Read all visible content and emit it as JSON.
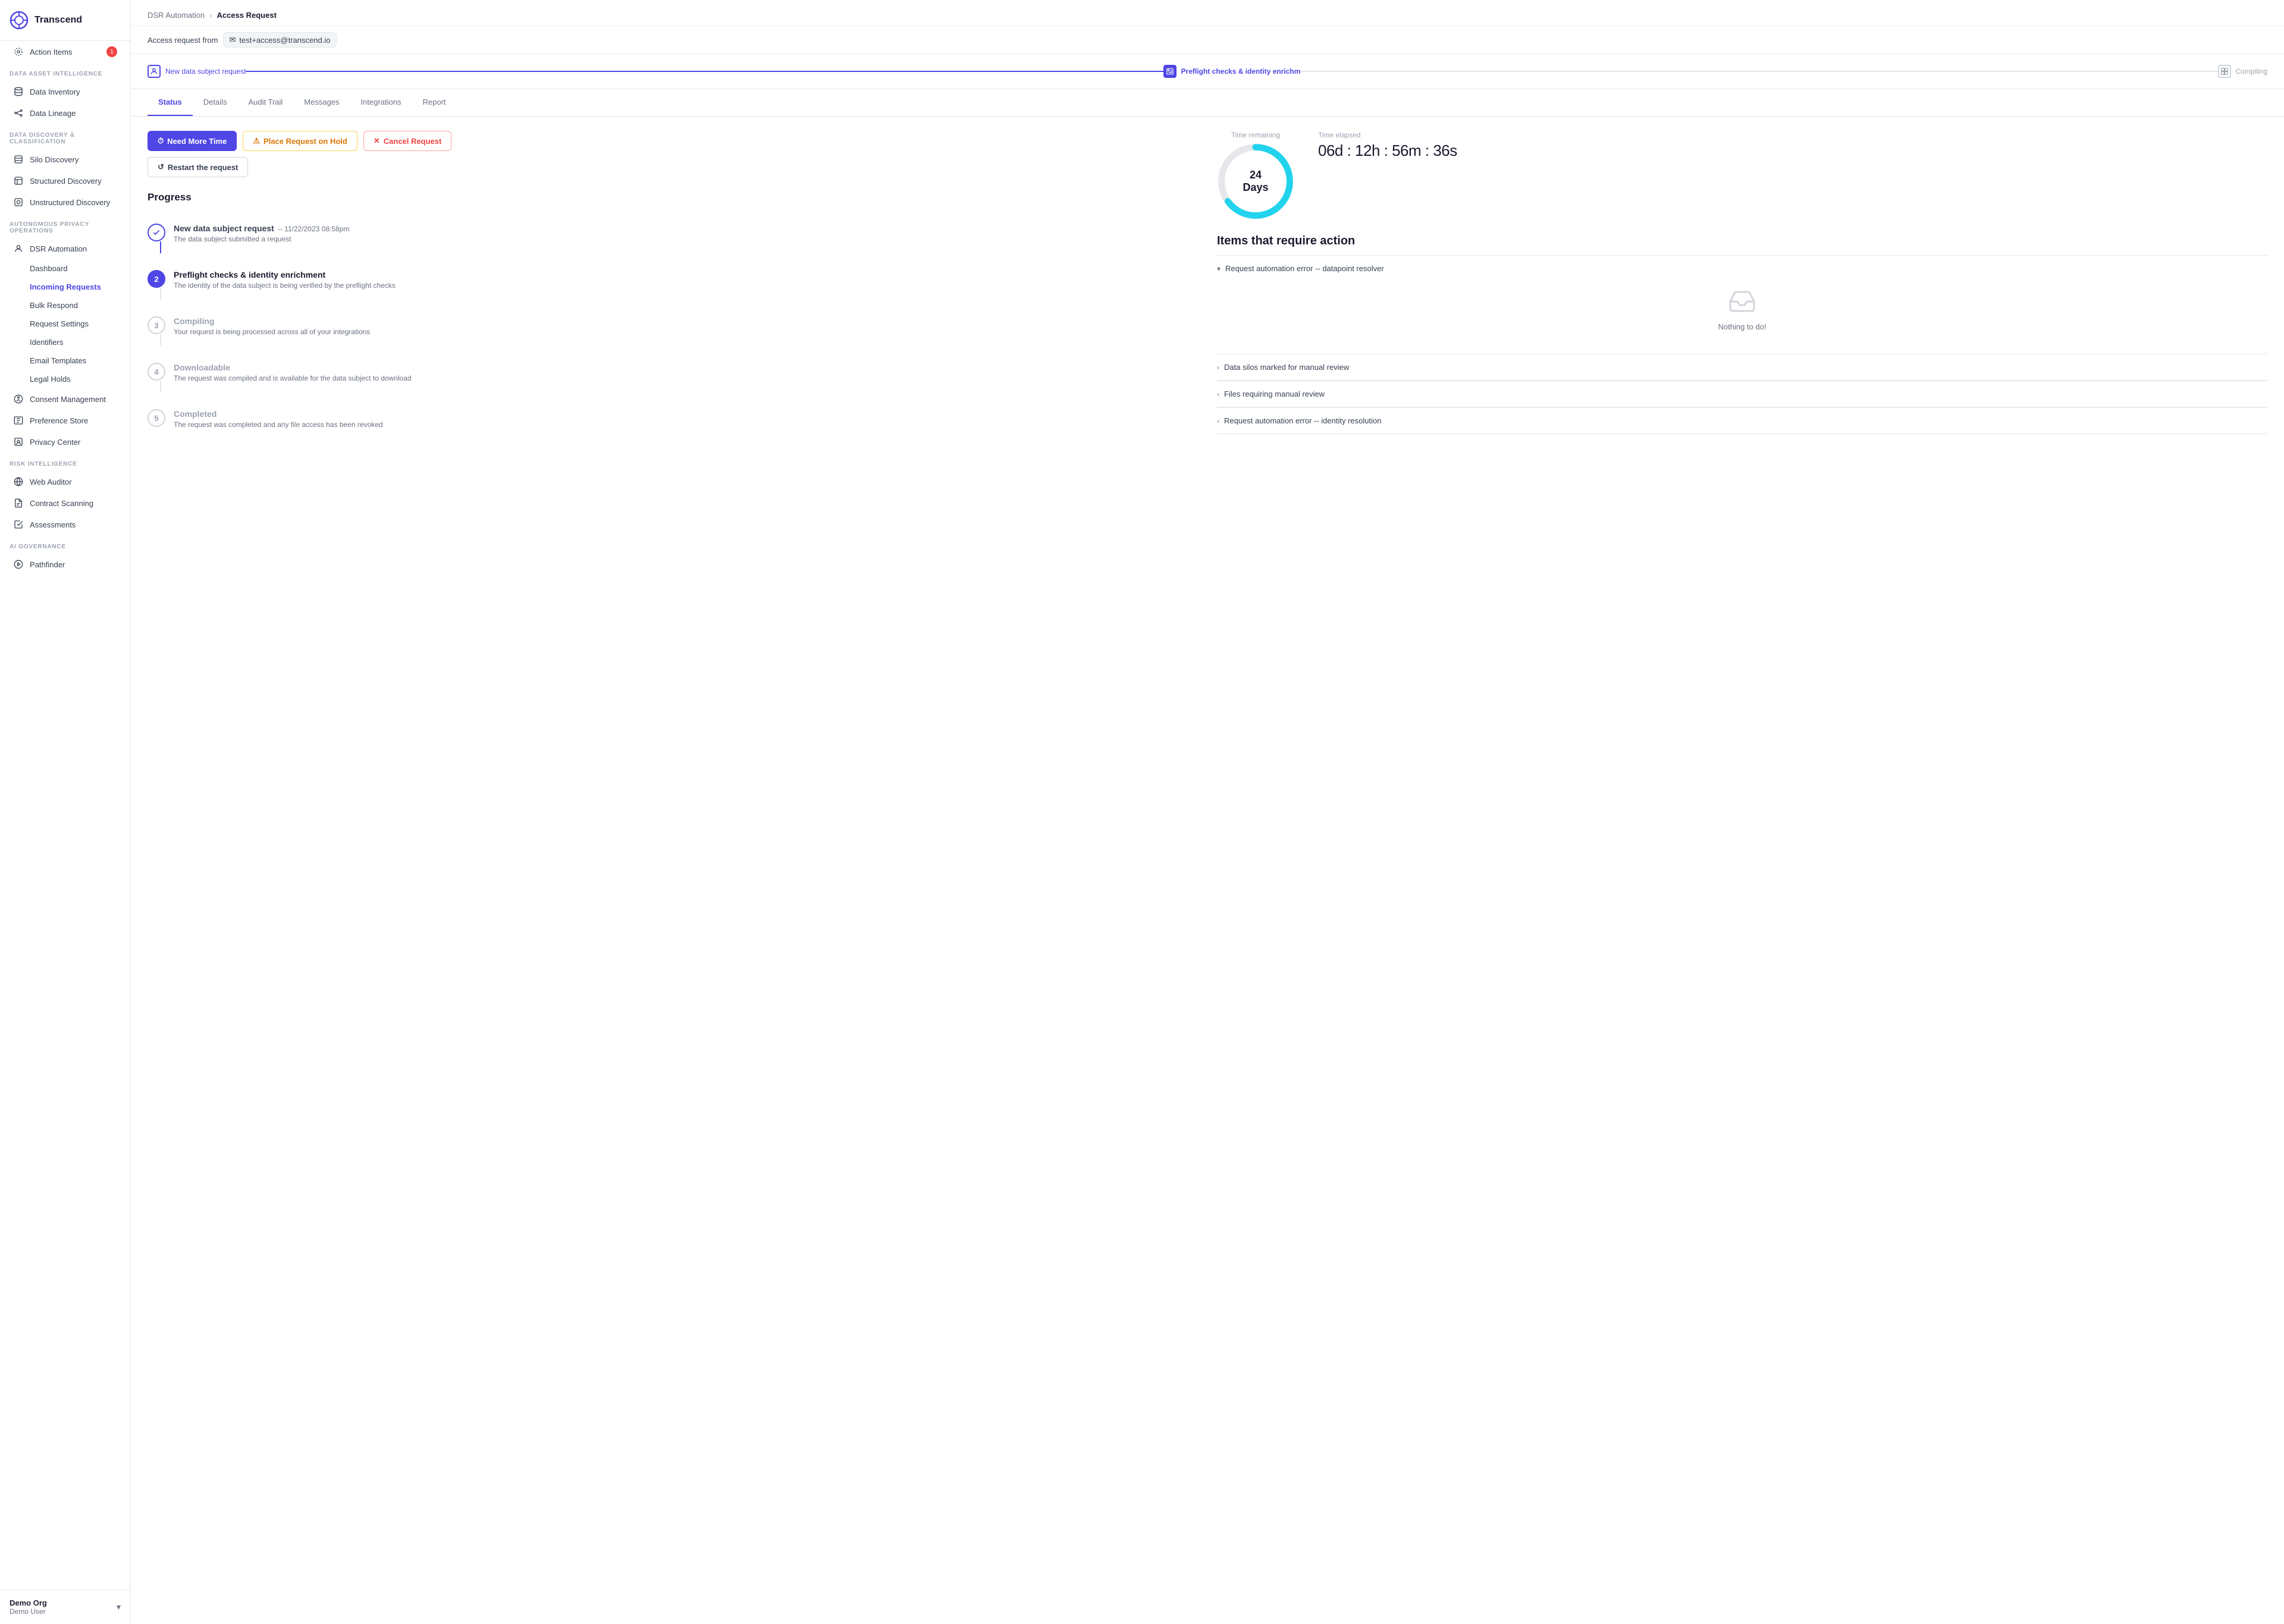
{
  "sidebar": {
    "logo": "Transcend",
    "sections": [
      {
        "label": "",
        "items": [
          {
            "id": "action-items",
            "label": "Action Items",
            "badge": "1",
            "icon": "bell"
          }
        ]
      },
      {
        "label": "Data Asset Intelligence",
        "items": [
          {
            "id": "data-inventory",
            "label": "Data Inventory",
            "icon": "database"
          },
          {
            "id": "data-lineage",
            "label": "Data Lineage",
            "icon": "lineage"
          }
        ]
      },
      {
        "label": "Data Discovery & Classification",
        "items": [
          {
            "id": "silo-discovery",
            "label": "Silo Discovery",
            "icon": "silo"
          },
          {
            "id": "structured-discovery",
            "label": "Structured Discovery",
            "icon": "structured"
          },
          {
            "id": "unstructured-discovery",
            "label": "Unstructured Discovery",
            "icon": "unstructured"
          }
        ]
      },
      {
        "label": "Autonomous Privacy Operations",
        "items": [
          {
            "id": "dsr-automation",
            "label": "DSR Automation",
            "icon": "dsr",
            "expandable": true
          },
          {
            "id": "dashboard",
            "label": "Dashboard",
            "sub": true
          },
          {
            "id": "incoming-requests",
            "label": "Incoming Requests",
            "sub": true,
            "active": true
          },
          {
            "id": "bulk-respond",
            "label": "Bulk Respond",
            "sub": true
          },
          {
            "id": "request-settings",
            "label": "Request Settings",
            "sub": true
          },
          {
            "id": "identifiers",
            "label": "Identifiers",
            "sub": true
          },
          {
            "id": "email-templates",
            "label": "Email Templates",
            "sub": true
          },
          {
            "id": "legal-holds",
            "label": "Legal Holds",
            "sub": true
          },
          {
            "id": "consent-management",
            "label": "Consent Management",
            "icon": "consent"
          },
          {
            "id": "preference-store",
            "label": "Preference Store",
            "icon": "preference"
          },
          {
            "id": "privacy-center",
            "label": "Privacy Center",
            "icon": "privacy"
          }
        ]
      },
      {
        "label": "Risk Intelligence",
        "items": [
          {
            "id": "web-auditor",
            "label": "Web Auditor",
            "icon": "web"
          },
          {
            "id": "contract-scanning",
            "label": "Contract Scanning",
            "icon": "contract"
          },
          {
            "id": "assessments",
            "label": "Assessments",
            "icon": "assessments"
          }
        ]
      },
      {
        "label": "AI Governance",
        "items": [
          {
            "id": "pathfinder",
            "label": "Pathfinder",
            "icon": "pathfinder"
          }
        ]
      }
    ],
    "footer": {
      "org": "Demo Org",
      "user": "Demo User"
    }
  },
  "breadcrumb": {
    "parent": "DSR Automation",
    "current": "Access Request"
  },
  "access_request": {
    "from_label": "Access request from",
    "email": "test+access@transcend.io"
  },
  "stepper": {
    "steps": [
      {
        "label": "New data subject request",
        "state": "done",
        "icon": "person"
      },
      {
        "label": "Preflight checks & identity enrichm",
        "state": "active",
        "icon": "id-card"
      },
      {
        "label": "Compiling",
        "state": "pending",
        "icon": "grid"
      }
    ]
  },
  "tabs": {
    "items": [
      {
        "id": "status",
        "label": "Status",
        "active": true
      },
      {
        "id": "details",
        "label": "Details"
      },
      {
        "id": "audit-trail",
        "label": "Audit Trail"
      },
      {
        "id": "messages",
        "label": "Messages"
      },
      {
        "id": "integrations",
        "label": "Integrations"
      },
      {
        "id": "report",
        "label": "Report"
      }
    ]
  },
  "action_buttons": [
    {
      "id": "need-more-time",
      "label": "Need More Time",
      "type": "primary",
      "icon": "⏱"
    },
    {
      "id": "place-on-hold",
      "label": "Place Request on Hold",
      "type": "warning",
      "icon": "⚠"
    },
    {
      "id": "cancel-request",
      "label": "Cancel Request",
      "type": "danger",
      "icon": "✕"
    },
    {
      "id": "restart-request",
      "label": "Restart the request",
      "type": "secondary",
      "icon": "↺"
    }
  ],
  "progress": {
    "title": "Progress",
    "steps": [
      {
        "num": "",
        "state": "done",
        "title": "New data subject request",
        "date": "11/22/2023 08:58pm",
        "desc": "The data subject submitted a request"
      },
      {
        "num": "2",
        "state": "current",
        "title": "Preflight checks & identity enrichment",
        "date": "",
        "desc": "The identity of the data subject is being verified by the preflight checks"
      },
      {
        "num": "3",
        "state": "pending",
        "title": "Compiling",
        "date": "",
        "desc": "Your request is being processed across all of your integrations"
      },
      {
        "num": "4",
        "state": "pending",
        "title": "Downloadable",
        "date": "",
        "desc": "The request was compiled and is available for the data subject to download"
      },
      {
        "num": "5",
        "state": "pending",
        "title": "Completed",
        "date": "",
        "desc": "The request was completed and any file access has been revoked"
      }
    ]
  },
  "timer": {
    "remaining_label": "Time remaining",
    "days_value": "24 Days",
    "donut_percent": 65,
    "elapsed_label": "Time elapsed",
    "elapsed_value": "06d : 12h : 56m : 36s"
  },
  "action_items": {
    "title": "Items that require action",
    "items": [
      {
        "id": "automation-error",
        "label": "Request automation error -- datapoint resolver",
        "expanded": true,
        "has_content": true,
        "nothing_todo": true,
        "nothing_todo_text": "Nothing to do!"
      },
      {
        "id": "manual-review-silos",
        "label": "Data silos marked for manual review",
        "expanded": false
      },
      {
        "id": "files-manual-review",
        "label": "Files requiring manual review",
        "expanded": false
      },
      {
        "id": "identity-resolution-error",
        "label": "Request automation error -- identity resolution",
        "expanded": false
      }
    ]
  },
  "colors": {
    "primary": "#4f46e5",
    "warning": "#d97706",
    "danger": "#ef4444",
    "donut_bg": "#e5e7eb",
    "donut_fill": "#22d3ee"
  }
}
